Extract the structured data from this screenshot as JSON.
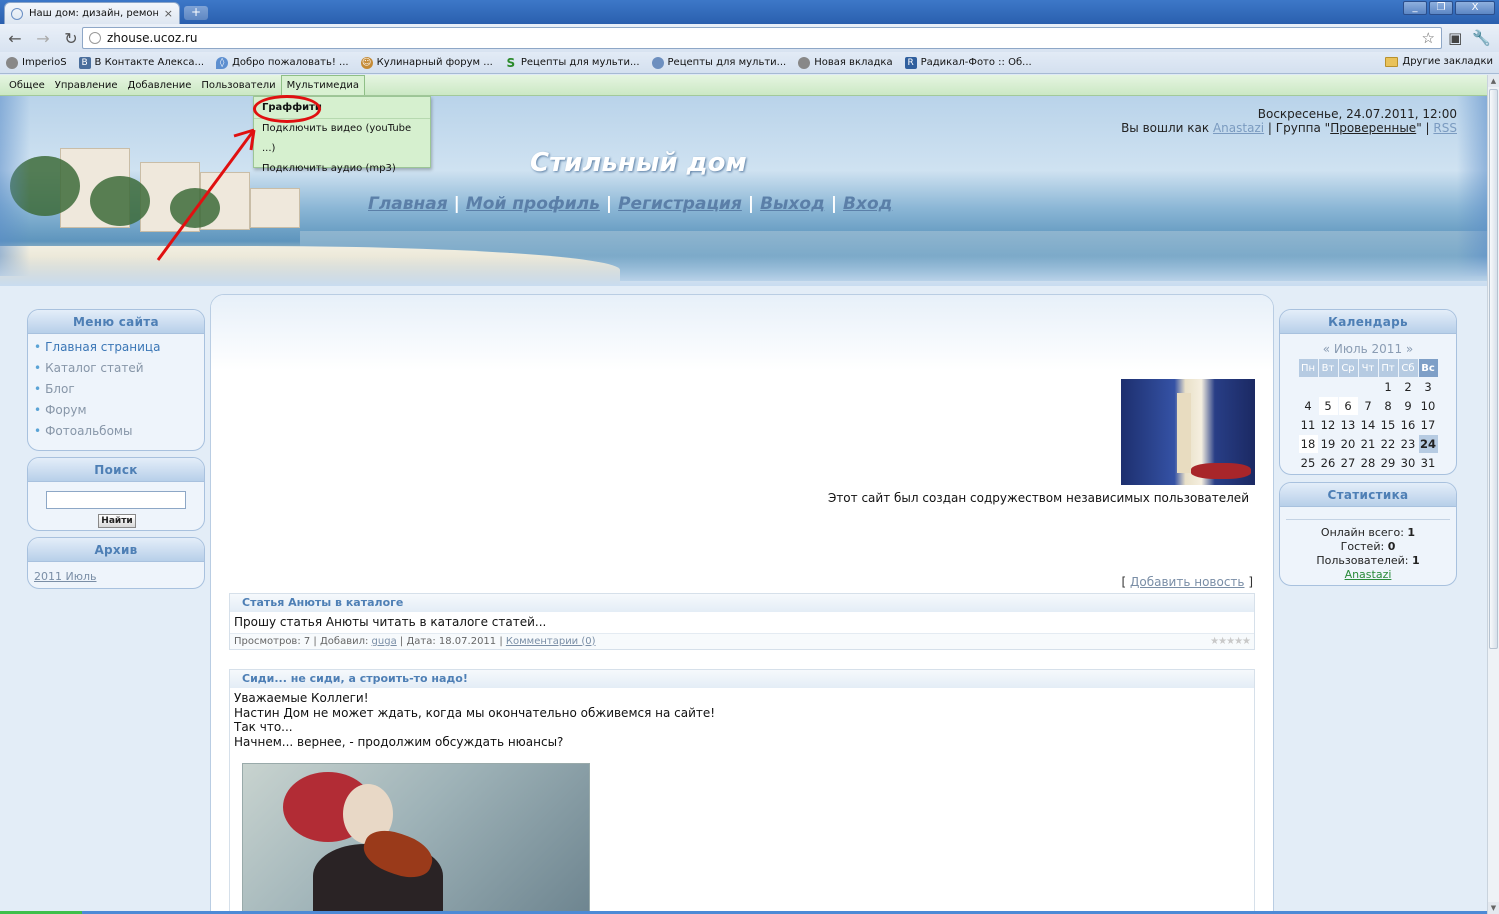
{
  "browser": {
    "tab_title": "Наш дом: дизайн, ремонт, о",
    "tab_close": "×",
    "newtab": "+",
    "url": "zhouse.ucoz.ru",
    "window_btns": [
      "_",
      "❐",
      "X"
    ],
    "bookmarks": [
      {
        "label": "ImperioS",
        "icon": "globe-icon"
      },
      {
        "label": "В Контакте Алекса...",
        "icon": "vk-icon"
      },
      {
        "label": "Добро пожаловать! ...",
        "icon": "blue-drop-icon"
      },
      {
        "label": "Кулинарный форум ...",
        "icon": "chef-icon"
      },
      {
        "label": "Рецепты для мульти...",
        "icon": "s-icon"
      },
      {
        "label": "Рецепты для мульти...",
        "icon": "globe-icon"
      },
      {
        "label": "Новая вкладка",
        "icon": "globe-icon"
      },
      {
        "label": "Радикал-Фото :: Об...",
        "icon": "radikal-icon"
      }
    ],
    "other_bookmarks": "Другие закладки"
  },
  "adminbar": {
    "items": [
      "Общее",
      "Управление",
      "Добавление",
      "Пользователи",
      "Мультимедиа"
    ],
    "dropdown": [
      "Граффити",
      "Подключить видео (youTube ...)",
      "Подключить аудио (mp3)"
    ]
  },
  "header": {
    "site_title": "Стильный дом",
    "nav": [
      "Главная",
      "Мой профиль",
      "Регистрация",
      "Выход",
      "Вход"
    ],
    "datetime": "Воскресенье, 24.07.2011, 12:00",
    "logged_prefix": "Вы вошли как",
    "user": "Anastazi",
    "group_prefix": "| Группа \"",
    "group": "Проверенные",
    "group_suffix": "\" |",
    "rss": "RSS"
  },
  "sidebar_left": {
    "menu_title": "Меню сайта",
    "menu": [
      "Главная страница",
      "Каталог статей",
      "Блог",
      "Форум",
      "Фотоальбомы"
    ],
    "search_title": "Поиск",
    "search_button": "Найти",
    "archive_title": "Архив",
    "archive_link": "2011 Июль"
  },
  "sidebar_right": {
    "calendar_title": "Календарь",
    "calendar_month": "«   Июль 2011   »",
    "day_names": [
      "Пн",
      "Вт",
      "Ср",
      "Чт",
      "Пт",
      "Сб",
      "Вс"
    ],
    "weeks": [
      [
        "",
        "",
        "",
        "",
        "1",
        "2",
        "3"
      ],
      [
        "4",
        "5",
        "6",
        "7",
        "8",
        "9",
        "10"
      ],
      [
        "11",
        "12",
        "13",
        "14",
        "15",
        "16",
        "17"
      ],
      [
        "18",
        "19",
        "20",
        "21",
        "22",
        "23",
        "24"
      ],
      [
        "25",
        "26",
        "27",
        "28",
        "29",
        "30",
        "31"
      ]
    ],
    "highlight_days": [
      "5",
      "6",
      "18"
    ],
    "today": "24",
    "stats_title": "Статистика",
    "online_label": "Онлайн всего:",
    "online_value": "1",
    "guests_label": "Гостей:",
    "guests_value": "0",
    "users_label": "Пользователей:",
    "users_value": "1",
    "online_user": "Anastazi"
  },
  "main": {
    "tagline": "Этот сайт был создан содружеством независимых пользователей",
    "add_news_open": "[",
    "add_news": "Добавить новость",
    "add_news_close": "]",
    "entries": [
      {
        "title": "Статья Анюты в каталоге",
        "body": [
          "Прошу статья Анюты читать в каталоге статей..."
        ],
        "views": "Просмотров: 7 | Добавил:",
        "author": "guga",
        "date": "| Дата: 18.07.2011 |",
        "comments": "Комментарии (0)",
        "rating": "★★★★★"
      },
      {
        "title": "Сиди... не сиди, а строить-то надо!",
        "body": [
          "Уважаемые Коллеги!",
          "Настин Дом не может ждать, когда мы окончательно обживемся на сайте!",
          "Так что...",
          "Начнем... вернее, - продолжим обсуждать нюансы?"
        ]
      }
    ]
  },
  "colors": {
    "accent": "#4e7fb5",
    "admin_green": "#cbe8c4",
    "annotation_red": "#e01010"
  }
}
